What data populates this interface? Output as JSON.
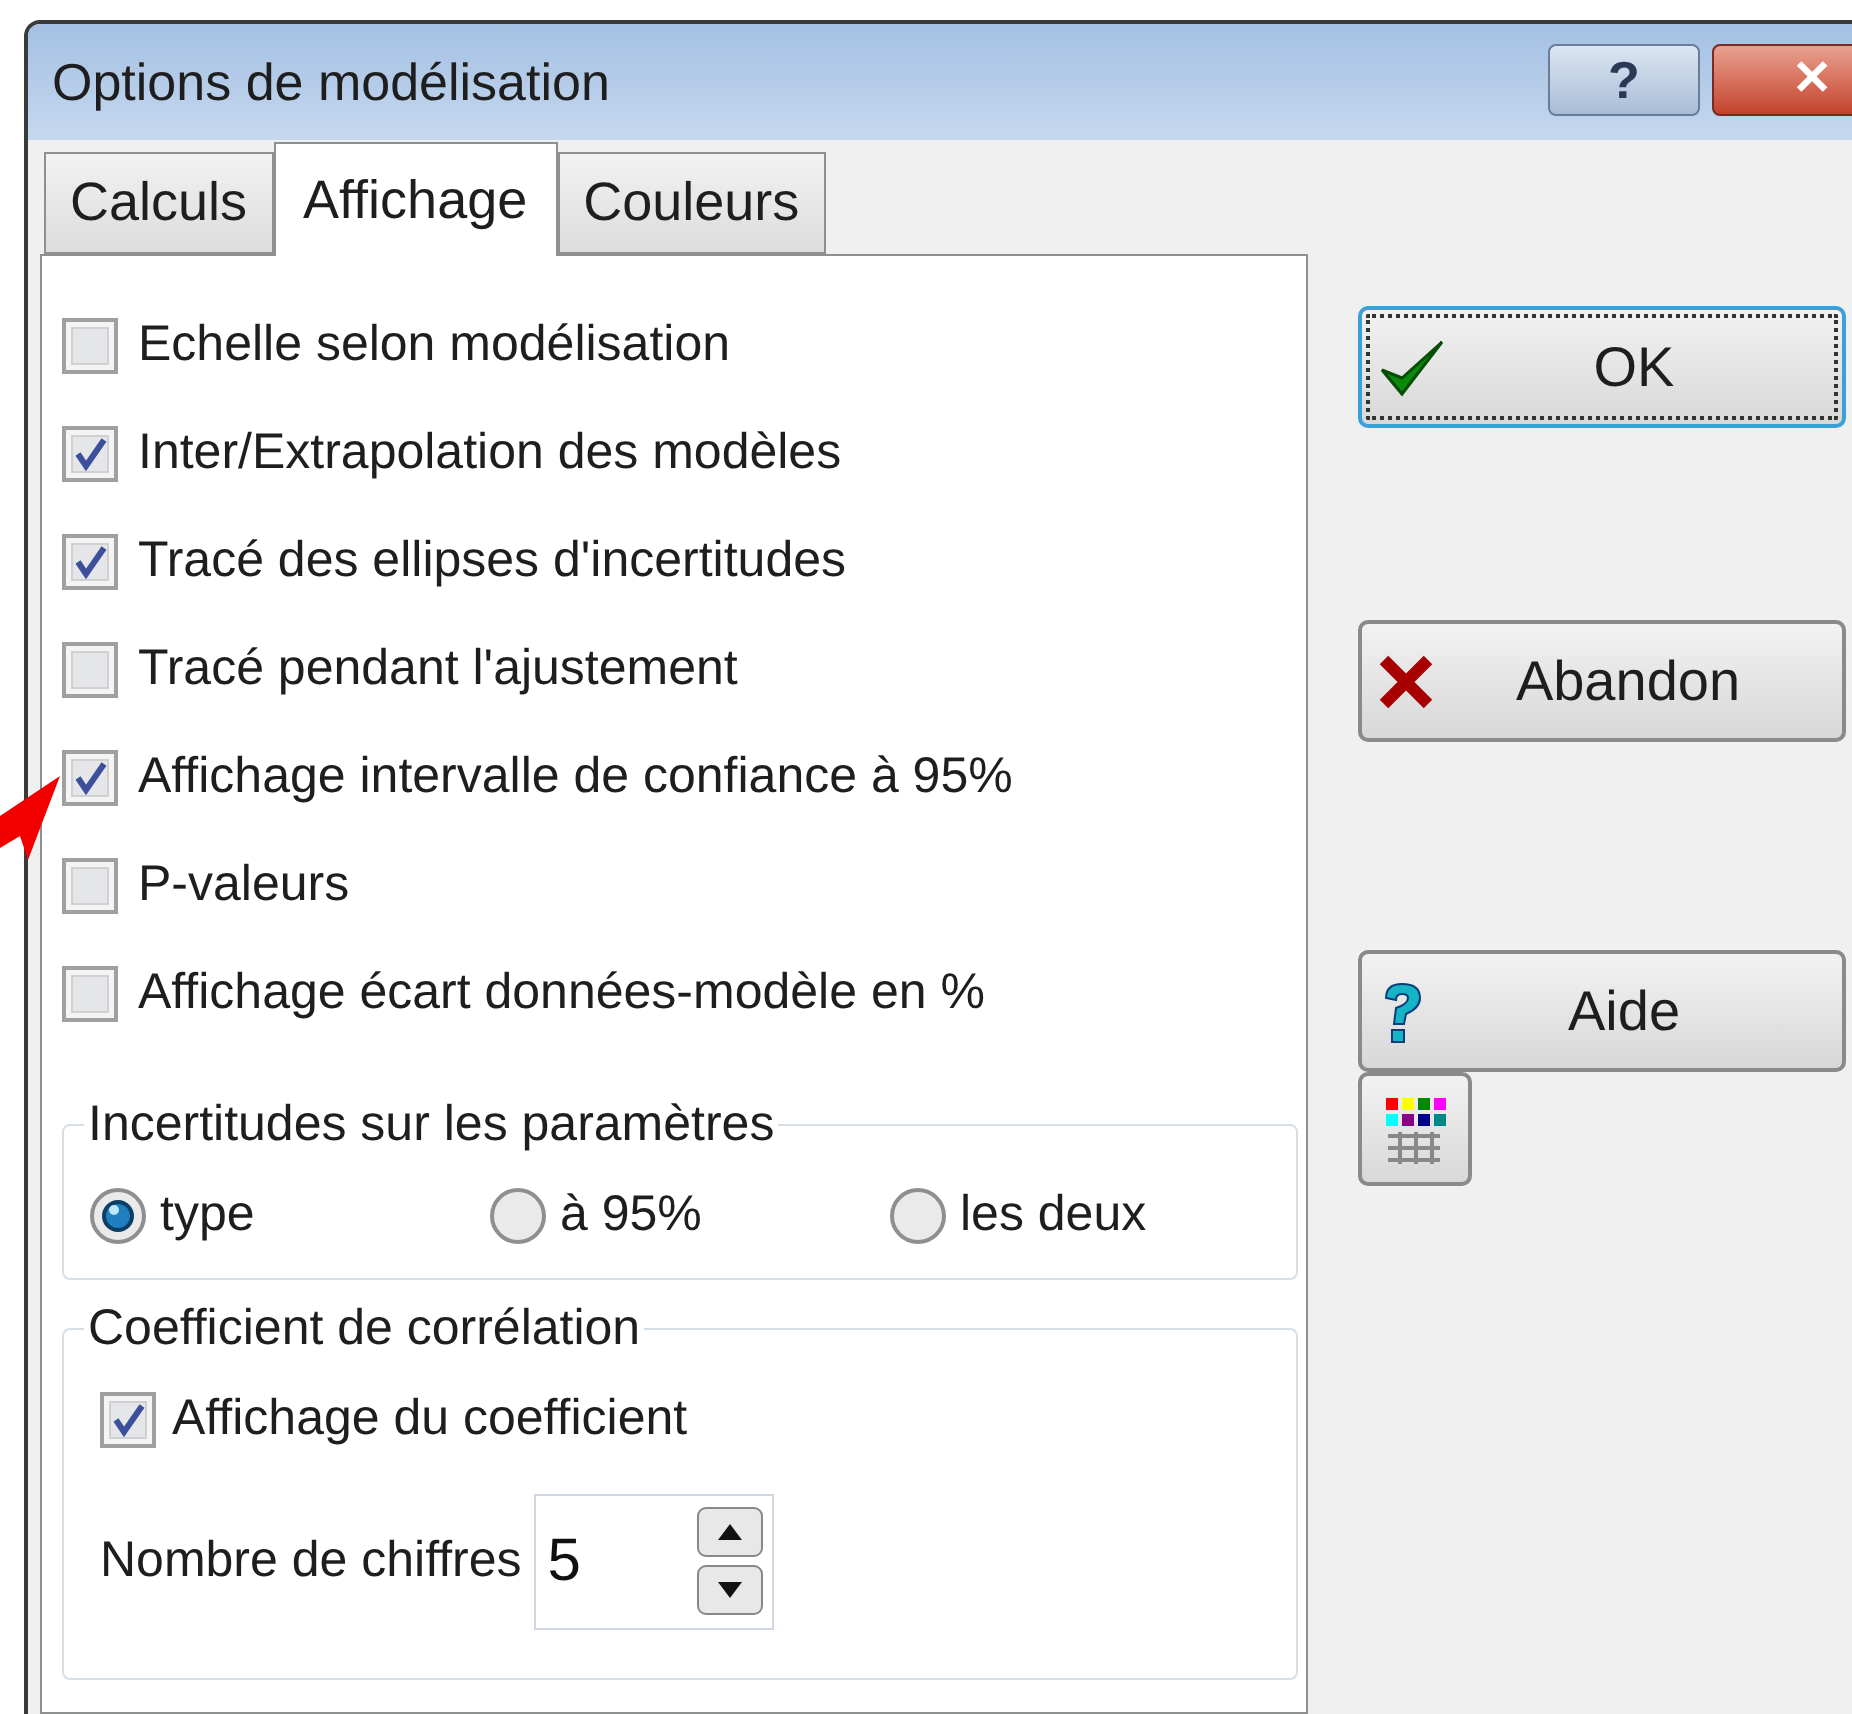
{
  "window": {
    "title": "Options de modélisation",
    "help_glyph": "?",
    "close_glyph": "✕"
  },
  "tabs": [
    {
      "label": "Calculs",
      "selected": false
    },
    {
      "label": "Affichage",
      "selected": true
    },
    {
      "label": "Couleurs",
      "selected": false
    }
  ],
  "options": [
    {
      "label": "Echelle selon modélisation",
      "checked": false
    },
    {
      "label": "Inter/Extrapolation des modèles",
      "checked": true
    },
    {
      "label": "Tracé des ellipses d'incertitudes",
      "checked": true
    },
    {
      "label": "Tracé pendant l'ajustement",
      "checked": false
    },
    {
      "label": "Affichage intervalle de confiance à 95%",
      "checked": true,
      "annotated": true
    },
    {
      "label": "P-valeurs",
      "checked": false
    },
    {
      "label": "Affichage écart données-modèle en %",
      "checked": false
    }
  ],
  "uncertainty_group": {
    "title": "Incertitudes sur les paramètres",
    "options": [
      {
        "label": "type",
        "selected": true
      },
      {
        "label": "à 95%",
        "selected": false
      },
      {
        "label": "les deux",
        "selected": false
      }
    ]
  },
  "correlation_group": {
    "title": "Coefficient de corrélation",
    "show_coefficient": {
      "label": "Affichage du coefficient",
      "checked": true
    },
    "digits": {
      "label": "Nombre de chiffres",
      "value": "5"
    }
  },
  "buttons": [
    {
      "kind": "ok",
      "label": "OK",
      "focused": true
    },
    {
      "kind": "cancel",
      "label": "Abandon",
      "focused": false
    },
    {
      "kind": "help",
      "label": "Aide",
      "focused": false
    },
    {
      "kind": "palette",
      "focused": false
    }
  ]
}
